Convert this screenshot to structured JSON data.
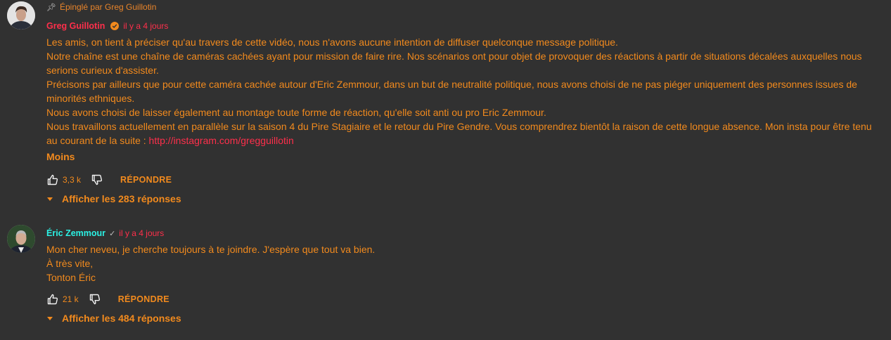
{
  "colors": {
    "background": "#313131",
    "text": "#f28a1d",
    "pinned_author": "#ff2f4b",
    "timestamp": "#ff2f4b",
    "link": "#ff2f4b",
    "author": "#2bf0e3"
  },
  "comments": [
    {
      "pinned_label": "Épinglé par Greg Guillotin",
      "author": "Greg Guillotin",
      "author_badge_icon": "check-circle-icon",
      "time": "il y a 4 jours",
      "lines": [
        "Les amis, on tient à préciser qu'au travers de cette vidéo, nous n'avons aucune intention de diffuser quelconque message politique.",
        "Notre chaîne est une chaîne de caméras cachées ayant pour mission de faire rire. Nos scénarios ont pour objet de provoquer des réactions à partir de situations décalées auxquelles nous serions curieux d'assister.",
        "Précisons par ailleurs que pour cette caméra cachée autour d'Eric Zemmour, dans un but de neutralité politique, nous avons choisi de ne pas piéger uniquement des personnes issues de minorités ethniques.",
        "Nous avons choisi de laisser également au montage toute forme de réaction, qu'elle soit anti ou pro Eric Zemmour."
      ],
      "last_line_prefix": "Nous travaillons actuellement en parallèle sur la saison 4 du Pire Stagiaire et le retour du Pire Gendre. Vous comprendrez bientôt la raison de cette longue absence. Mon insta pour être tenu au courant de la suite : ",
      "link": "http://instagram.com/gregguillotin",
      "show_less": "Moins",
      "likes": "3,3 k",
      "reply_label": "RÉPONDRE",
      "view_replies": "Afficher les 283 réponses"
    },
    {
      "author": "Éric Zemmour",
      "verified_mark": "✓",
      "time": "il y a 4 jours",
      "lines": [
        "Mon cher neveu, je cherche toujours à te joindre. J'espère que tout va bien.",
        "À très vite,",
        "Tonton Éric"
      ],
      "likes": "21 k",
      "reply_label": "RÉPONDRE",
      "view_replies": "Afficher les 484 réponses"
    }
  ]
}
